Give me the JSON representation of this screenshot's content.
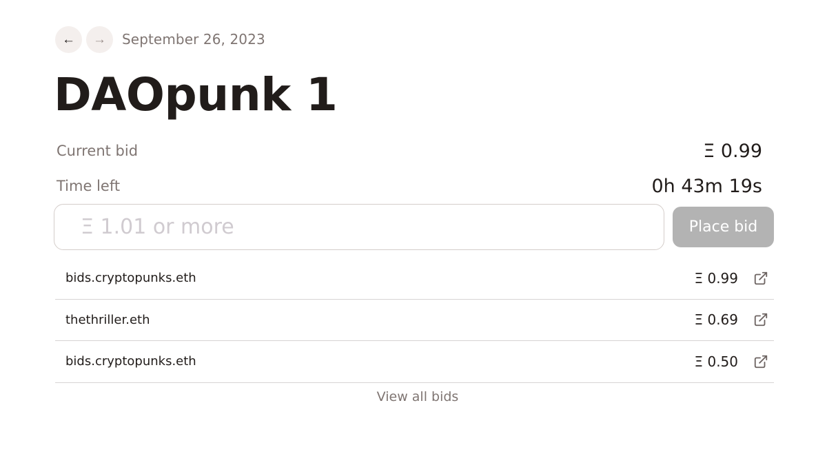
{
  "nav": {
    "prev_icon": "←",
    "next_icon": "→",
    "date": "September 26, 2023"
  },
  "auction": {
    "title": "DAOpunk 1",
    "current_bid_label": "Current bid",
    "current_bid_value": "Ξ 0.99",
    "time_left_label": "Time left",
    "time_left_value": "0h 43m 19s"
  },
  "bid_form": {
    "placeholder": "Ξ 1.01 or more",
    "button_label": "Place bid"
  },
  "bids": [
    {
      "bidder": "bids.cryptopunks.eth",
      "amount": "Ξ 0.99"
    },
    {
      "bidder": "thethriller.eth",
      "amount": "Ξ 0.69"
    },
    {
      "bidder": "bids.cryptopunks.eth",
      "amount": "Ξ 0.50"
    }
  ],
  "view_all_label": "View all bids",
  "colors": {
    "text": "#211c1a",
    "muted": "#7f7572",
    "button_disabled": "#b3b3b3",
    "nav_button_bg": "#f4efed"
  }
}
